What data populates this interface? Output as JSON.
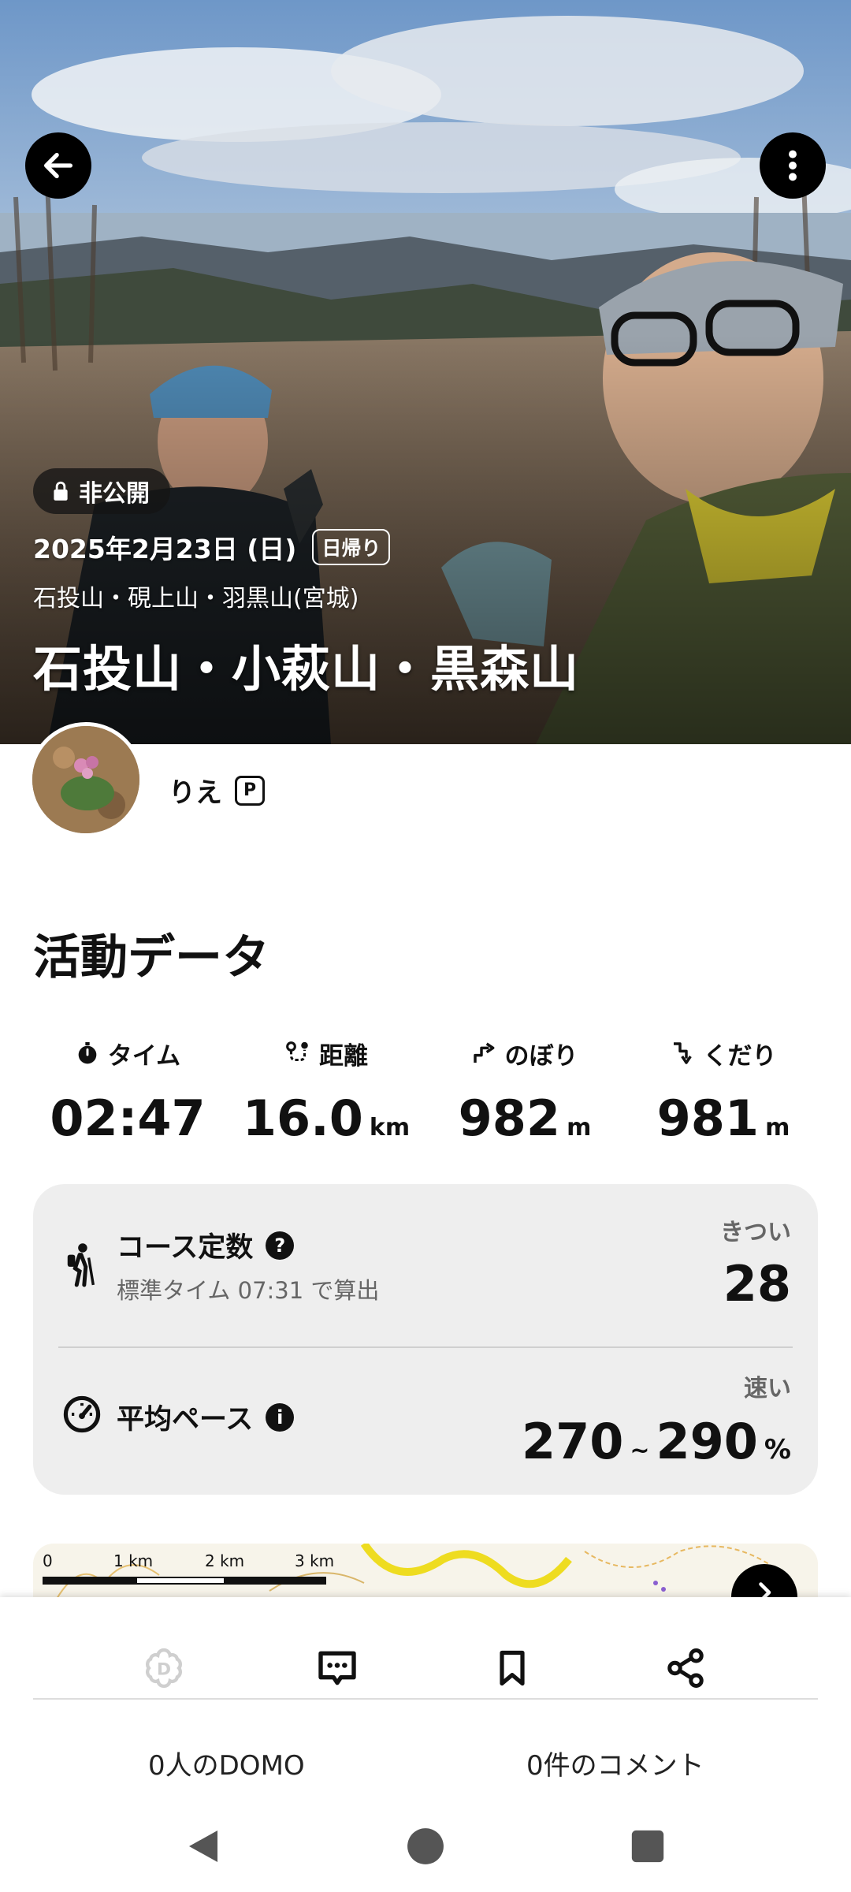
{
  "hero": {
    "visibility_badge": "非公開",
    "date": "2025年2月23日 (日)",
    "trip_type": "日帰り",
    "area": "石投山・硯上山・羽黒山(宮城)",
    "title": "石投山・小萩山・黒森山",
    "icons": {
      "back": "arrow-left-icon",
      "more": "more-vertical-icon",
      "lock": "lock-icon"
    }
  },
  "user": {
    "name": "りえ",
    "premium_badge": "P"
  },
  "activity": {
    "section_title": "活動データ",
    "stats": [
      {
        "icon": "stopwatch-icon",
        "label": "タイム",
        "value": "02:47",
        "unit": ""
      },
      {
        "icon": "route-icon",
        "label": "距離",
        "value": "16.0",
        "unit": "km"
      },
      {
        "icon": "ascent-icon",
        "label": "のぼり",
        "value": "982",
        "unit": "m"
      },
      {
        "icon": "descent-icon",
        "label": "くだり",
        "value": "981",
        "unit": "m"
      }
    ],
    "course_constant": {
      "title": "コース定数",
      "subtitle": "標準タイム 07:31 で算出",
      "level": "きつい",
      "value": "28",
      "help_icon": "?"
    },
    "average_pace": {
      "title": "平均ペース",
      "level": "速い",
      "min": "270",
      "separator": "~",
      "max": "290",
      "unit": "%",
      "info_icon": "i"
    }
  },
  "map": {
    "scale_labels": [
      "0",
      "1 km",
      "2 km",
      "3 km"
    ]
  },
  "bottom_bar": {
    "domo_count": "0人のDOMO",
    "comment_count": "0件のコメント",
    "icons": [
      "domo-icon",
      "comment-icon",
      "bookmark-icon",
      "share-icon"
    ]
  }
}
